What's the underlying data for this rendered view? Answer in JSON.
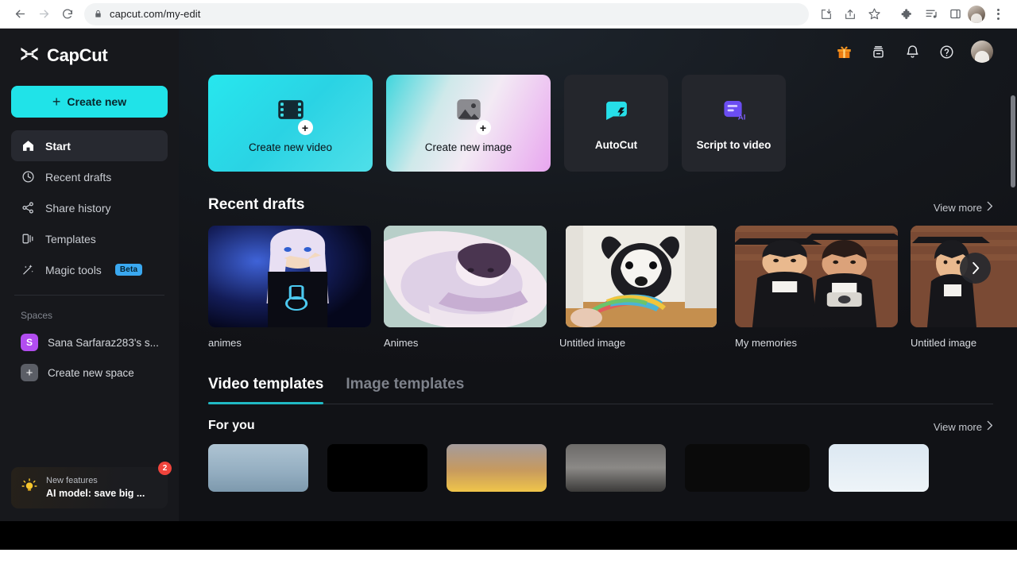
{
  "browser": {
    "url_display": "capcut.com/my-edit",
    "url_host": "capcut.com",
    "url_path": "/my-edit",
    "back_label": "Back",
    "forward_label": "Forward",
    "reload_label": "Reload",
    "lock_label": "site-information",
    "icons": [
      "download-icon",
      "share-icon",
      "bookmark-star-icon",
      "extensions-icon",
      "reading-list-icon",
      "side-panel-icon",
      "profile-avatar",
      "menu-kebab-icon"
    ]
  },
  "sidebar": {
    "brand": "CapCut",
    "create_new_label": "Create new",
    "create_new_plus": "+",
    "items": [
      {
        "label": "Start",
        "icon": "home-icon",
        "active": true
      },
      {
        "label": "Recent drafts",
        "icon": "clock-icon",
        "active": false
      },
      {
        "label": "Share history",
        "icon": "share-nodes-icon",
        "active": false
      },
      {
        "label": "Templates",
        "icon": "templates-icon",
        "active": false
      },
      {
        "label": "Magic tools",
        "icon": "magic-wand-icon",
        "active": false,
        "badge": "Beta"
      }
    ],
    "spaces_label": "Spaces",
    "spaces": [
      {
        "label": "Sana Sarfaraz283's s...",
        "avatar_letter": "S",
        "avatar_color": "#b24df0"
      },
      {
        "label": "Create new space",
        "avatar_letter": "+",
        "avatar_color": "#5b5e66"
      }
    ],
    "promo": {
      "icon": "lightbulb-icon",
      "title": "New features",
      "subtitle": "AI model: save big ...",
      "badge": "2"
    }
  },
  "header": {
    "icons": [
      {
        "name": "gift-icon",
        "color": "#f59219"
      },
      {
        "name": "cloud-storage-icon",
        "color": "#e3e5e9"
      },
      {
        "name": "notification-bell-icon",
        "color": "#e3e5e9"
      },
      {
        "name": "help-circle-icon",
        "color": "#e3e5e9"
      }
    ],
    "avatar_label": "user-avatar"
  },
  "actions": [
    {
      "label": "Create new video",
      "icon": "film-plus-icon",
      "style": "video"
    },
    {
      "label": "Create new image",
      "icon": "image-plus-icon",
      "style": "image"
    },
    {
      "label": "AutoCut",
      "icon": "autocut-bolt-icon",
      "style": "dark"
    },
    {
      "label": "Script to video",
      "icon": "script-ai-icon",
      "style": "dark"
    }
  ],
  "recent_drafts": {
    "title": "Recent drafts",
    "view_more": "View more",
    "next_arrow": "›",
    "items": [
      {
        "name": "animes",
        "art": "art-anime1"
      },
      {
        "name": "Animes",
        "art": "art-anime2"
      },
      {
        "name": "Untitled image",
        "art": "art-dog"
      },
      {
        "name": "My memories",
        "art": "art-grad"
      },
      {
        "name": "Untitled image",
        "art": "art-grad"
      }
    ]
  },
  "templates": {
    "tabs": [
      {
        "label": "Video templates",
        "active": true
      },
      {
        "label": "Image templates",
        "active": false
      }
    ],
    "for_you": {
      "title": "For you",
      "view_more": "View more"
    },
    "thumbs": [
      "tpl-a",
      "tpl-b",
      "tpl-c",
      "tpl-d",
      "tpl-e",
      "tpl-f"
    ]
  },
  "colors": {
    "accent_cyan": "#20e3e8",
    "tab_underline": "#20b9c4",
    "sidebar_bg": "#17181c",
    "main_bg": "#111216",
    "badge_red": "#f0443c",
    "beta_blue": "#3aa8f0"
  }
}
